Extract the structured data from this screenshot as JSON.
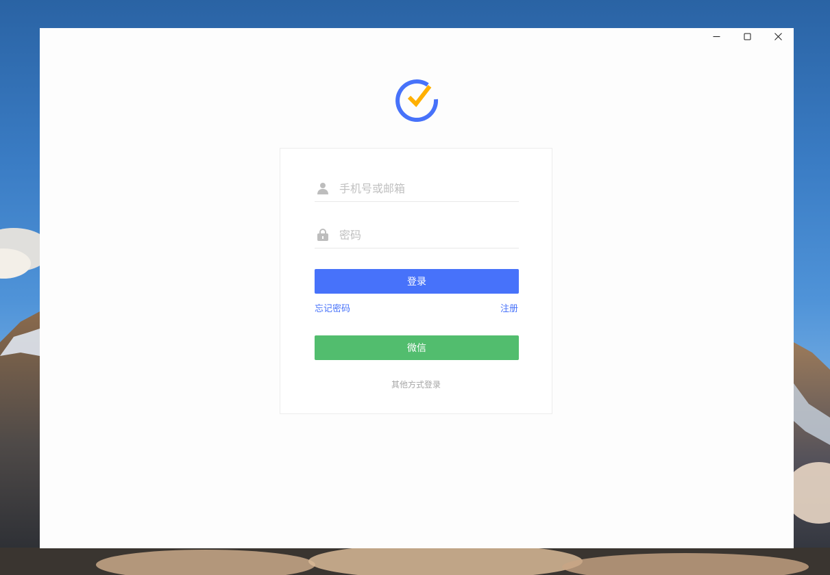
{
  "window": {
    "controls": [
      "minimize-icon",
      "maximize-icon",
      "close-icon"
    ]
  },
  "logo": {
    "icon": "checkmark-circle-logo",
    "ring_color": "#4772fa",
    "check_color": "#ffb000"
  },
  "login": {
    "account_placeholder": "手机号或邮箱",
    "account_icon": "user-icon",
    "password_placeholder": "密码",
    "password_icon": "lock-icon",
    "login_label": "登录",
    "forgot_label": "忘记密码",
    "register_label": "注册",
    "wechat_label": "微信",
    "other_label": "其他方式登录"
  },
  "colors": {
    "primary": "#4772fa",
    "wechat": "#52bd6e",
    "muted": "#a6a6a6"
  }
}
